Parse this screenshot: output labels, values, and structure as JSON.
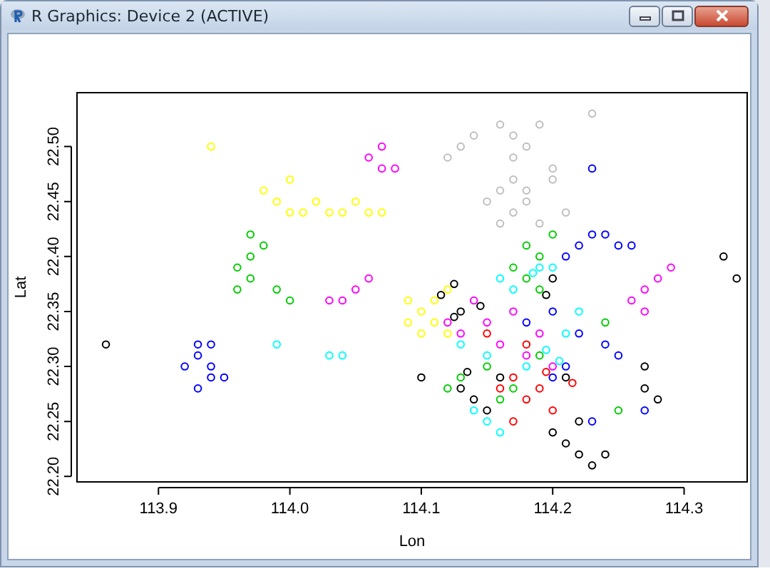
{
  "window": {
    "title": "R Graphics: Device 2 (ACTIVE)"
  },
  "plot": {
    "chart_data": {
      "type": "scatter",
      "xlabel": "Lon",
      "ylabel": "Lat",
      "xlim": [
        113.838,
        114.348
      ],
      "ylim": [
        22.195,
        22.549
      ],
      "xticks": [
        {
          "value": 113.9,
          "label": "113.9"
        },
        {
          "value": 114.0,
          "label": "114.0"
        },
        {
          "value": 114.1,
          "label": "114.1"
        },
        {
          "value": 114.2,
          "label": "114.2"
        },
        {
          "value": 114.3,
          "label": "114.3"
        }
      ],
      "yticks": [
        {
          "value": 22.2,
          "label": "22.20"
        },
        {
          "value": 22.25,
          "label": "22.25"
        },
        {
          "value": 22.3,
          "label": "22.30"
        },
        {
          "value": 22.35,
          "label": "22.35"
        },
        {
          "value": 22.4,
          "label": "22.40"
        },
        {
          "value": 22.45,
          "label": "22.45"
        },
        {
          "value": 22.5,
          "label": "22.50"
        }
      ],
      "series": [
        {
          "color": "#bebebe",
          "x": [
            114.15,
            114.16,
            114.17,
            114.18,
            114.17,
            114.16,
            114.18,
            114.19,
            114.2,
            114.17,
            114.18,
            114.13,
            114.12,
            114.14,
            114.23,
            114.21,
            114.19,
            114.16,
            114.17,
            114.2
          ],
          "values": [
            22.45,
            22.46,
            22.44,
            22.45,
            22.47,
            22.43,
            22.5,
            22.52,
            22.48,
            22.51,
            22.46,
            22.5,
            22.49,
            22.51,
            22.53,
            22.44,
            22.43,
            22.52,
            22.49,
            22.47
          ]
        },
        {
          "color": "#ffff00",
          "x": [
            113.94,
            113.98,
            113.99,
            114.0,
            114.01,
            114.02,
            114.0,
            114.03,
            114.04,
            114.05,
            114.06,
            114.07,
            114.09,
            114.1,
            114.11,
            114.1,
            114.12,
            114.11,
            114.09,
            114.12
          ],
          "values": [
            22.5,
            22.46,
            22.45,
            22.47,
            22.44,
            22.45,
            22.44,
            22.44,
            22.44,
            22.45,
            22.44,
            22.44,
            22.36,
            22.35,
            22.34,
            22.33,
            22.37,
            22.36,
            22.34,
            22.33
          ]
        },
        {
          "color": "#00cd00",
          "x": [
            113.96,
            113.97,
            113.97,
            113.98,
            113.96,
            113.97,
            113.99,
            114.0,
            114.17,
            114.18,
            114.19,
            114.2,
            114.18,
            114.19,
            114.12,
            114.13,
            114.15,
            114.16,
            114.17,
            114.19,
            114.24,
            114.25
          ],
          "values": [
            22.39,
            22.4,
            22.38,
            22.41,
            22.37,
            22.42,
            22.37,
            22.36,
            22.39,
            22.41,
            22.4,
            22.42,
            22.38,
            22.37,
            22.28,
            22.29,
            22.3,
            22.27,
            22.28,
            22.31,
            22.34,
            22.26
          ]
        },
        {
          "color": "#0000ff",
          "x": [
            113.93,
            113.93,
            113.94,
            113.94,
            113.93,
            113.95,
            113.92,
            113.94,
            114.21,
            114.22,
            114.23,
            114.24,
            114.25,
            114.26,
            114.23,
            114.2,
            114.21,
            114.22,
            114.24,
            114.25,
            114.27,
            114.23,
            114.2,
            114.18
          ],
          "values": [
            22.32,
            22.31,
            22.3,
            22.29,
            22.28,
            22.29,
            22.3,
            22.32,
            22.4,
            22.41,
            22.42,
            22.42,
            22.41,
            22.41,
            22.48,
            22.29,
            22.3,
            22.33,
            22.32,
            22.31,
            22.26,
            22.25,
            22.35,
            22.34
          ]
        },
        {
          "color": "#ff00ff",
          "x": [
            114.06,
            114.07,
            114.08,
            114.07,
            114.05,
            114.04,
            114.03,
            114.06,
            114.26,
            114.27,
            114.28,
            114.29,
            114.27,
            114.12,
            114.13,
            114.15,
            114.16,
            114.17,
            114.19,
            114.2,
            114.14,
            114.18
          ],
          "values": [
            22.49,
            22.48,
            22.48,
            22.5,
            22.37,
            22.36,
            22.36,
            22.38,
            22.36,
            22.37,
            22.38,
            22.39,
            22.35,
            22.34,
            22.33,
            22.34,
            22.32,
            22.35,
            22.33,
            22.3,
            22.36,
            22.31
          ]
        },
        {
          "color": "#00ffff",
          "x": [
            114.03,
            114.04,
            113.99,
            114.16,
            114.17,
            114.185,
            114.19,
            114.2,
            114.15,
            114.14,
            114.16,
            114.18,
            114.195,
            114.205,
            114.21,
            114.22,
            114.13,
            114.15
          ],
          "values": [
            22.31,
            22.31,
            22.32,
            22.38,
            22.37,
            22.385,
            22.39,
            22.39,
            22.25,
            22.26,
            22.24,
            22.3,
            22.315,
            22.305,
            22.33,
            22.35,
            22.32,
            22.31
          ]
        },
        {
          "color": "#000000",
          "x": [
            113.86,
            114.115,
            114.125,
            114.13,
            114.145,
            114.125,
            114.13,
            114.14,
            114.15,
            114.16,
            114.135,
            114.2,
            114.21,
            114.22,
            114.23,
            114.24,
            114.22,
            114.27,
            114.27,
            114.28,
            114.34,
            114.33,
            114.195,
            114.2,
            114.21,
            114.1
          ],
          "values": [
            22.32,
            22.365,
            22.375,
            22.35,
            22.355,
            22.345,
            22.28,
            22.27,
            22.26,
            22.29,
            22.295,
            22.24,
            22.23,
            22.22,
            22.21,
            22.22,
            22.25,
            22.3,
            22.28,
            22.27,
            22.38,
            22.4,
            22.365,
            22.38,
            22.29,
            22.29
          ]
        },
        {
          "color": "#ff0000",
          "x": [
            114.16,
            114.17,
            114.18,
            114.19,
            114.195,
            114.215,
            114.17,
            114.15,
            114.18,
            114.2
          ],
          "values": [
            22.28,
            22.29,
            22.27,
            22.28,
            22.295,
            22.285,
            22.25,
            22.33,
            22.32,
            22.26
          ]
        }
      ]
    }
  }
}
